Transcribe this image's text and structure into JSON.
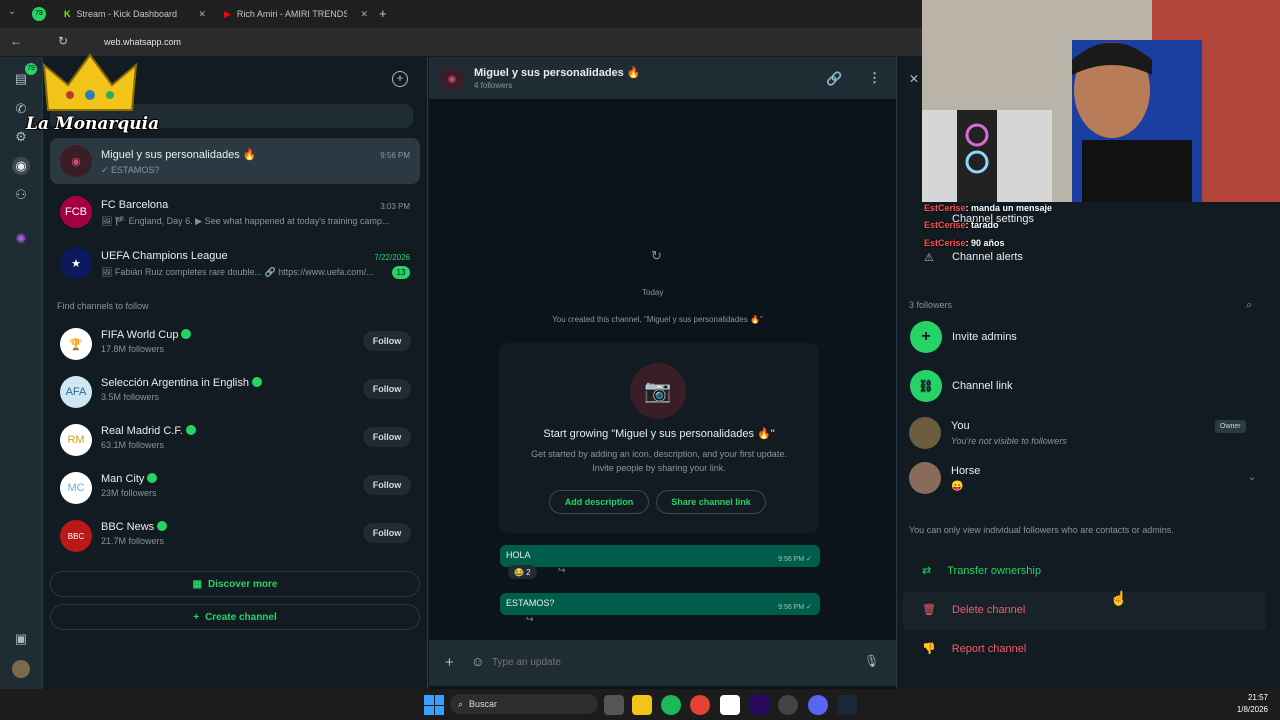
{
  "browser": {
    "tabs": [
      {
        "label": "Stream - Kick Dashboard"
      },
      {
        "label": "Rich Amiri - AMIRI TRENDSETT"
      }
    ],
    "tab_badge": "78",
    "url": "web.whatsapp.com"
  },
  "overlay": {
    "logo_text": "La Monarquia",
    "rail_badge": "79"
  },
  "chatlist": {
    "chats": [
      {
        "name": "Miguel y sus personalidades 🔥",
        "preview": "✓ ESTAMOS?",
        "time": "9:56 PM"
      },
      {
        "name": "FC Barcelona",
        "preview": "🖼 🏴 England, Day 6. ▶ See what happened at today's training camp...",
        "time": "3:03 PM"
      },
      {
        "name": "UEFA Champions League",
        "preview": "🖼 Fabián Ruiz completes rare double... 🔗 https://www.uefa.com/...",
        "time": "7/22/2026",
        "unread": "13"
      }
    ],
    "find_title": "Find channels to follow",
    "suggestions": [
      {
        "name": "FIFA World Cup",
        "followers": "17.8M followers",
        "btn": "Follow"
      },
      {
        "name": "Selección Argentina in English",
        "followers": "3.5M followers",
        "btn": "Follow"
      },
      {
        "name": "Real Madrid C.F.",
        "followers": "63.1M followers",
        "btn": "Follow"
      },
      {
        "name": "Man City",
        "followers": "23M followers",
        "btn": "Follow"
      },
      {
        "name": "BBC News",
        "followers": "21.7M followers",
        "btn": "Follow"
      }
    ],
    "discover": "Discover more",
    "create": "Create channel"
  },
  "chat": {
    "title": "Miguel y sus personalidades 🔥",
    "subtitle": "4 followers",
    "date": "Today",
    "system_msg": "You created this channel, \"Miguel y sus personalidades 🔥\"",
    "card_title": "Start growing \"Miguel y sus personalidades 🔥\"",
    "card_desc1": "Get started by adding an icon, description, and your first update.",
    "card_desc2": "Invite people by sharing your link.",
    "add_desc": "Add description",
    "share_link": "Share channel link",
    "messages": [
      {
        "text": "HOLA",
        "time": "9:56 PM ✓",
        "reactions": "😂 2"
      },
      {
        "text": "ESTAMOS?",
        "time": "9:56 PM ✓"
      }
    ],
    "placeholder": "Type an update"
  },
  "info": {
    "settings": "Channel settings",
    "alerts": "Channel alerts",
    "followers_count": "3 followers",
    "invite": "Invite admins",
    "link": "Channel link",
    "you_name": "You",
    "you_sub": "You're not visible to followers",
    "owner": "Owner",
    "horse_name": "Horse",
    "horse_sub": "😛",
    "note": "You can only view individual followers who are contacts or admins.",
    "transfer": "Transfer ownership",
    "delete": "Delete channel",
    "report": "Report channel"
  },
  "stream_chat": [
    {
      "user": "EstCerise",
      "msg": ": manda un mensaje"
    },
    {
      "user": "EstCerise",
      "msg": ": tarado"
    },
    {
      "user": "EstCerise",
      "msg": ": 90 años"
    }
  ],
  "taskbar": {
    "search": "Buscar",
    "time": "21:57",
    "date": "1/8/2026"
  },
  "colors": {
    "accent": "#25d366",
    "bubble": "#005c4b",
    "danger": "#f15c6d"
  }
}
